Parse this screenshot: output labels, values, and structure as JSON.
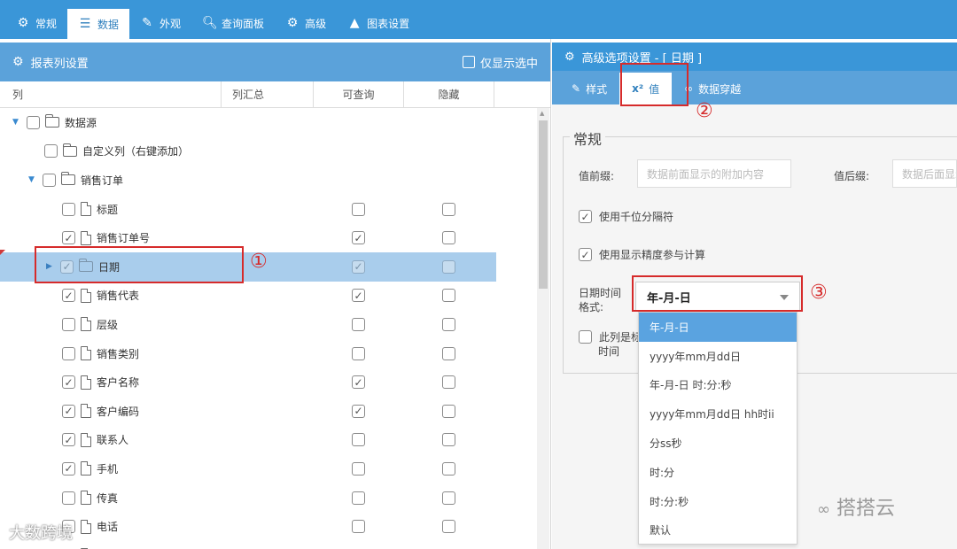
{
  "top_tabs": [
    {
      "label": "常规",
      "icon": "gear-icon"
    },
    {
      "label": "数据",
      "icon": "database-icon"
    },
    {
      "label": "外观",
      "icon": "magic-wand-icon"
    },
    {
      "label": "查询面板",
      "icon": "search-icon"
    },
    {
      "label": "高级",
      "icon": "gears-icon"
    },
    {
      "label": "图表设置",
      "icon": "area-chart-icon"
    }
  ],
  "active_top_tab": "数据",
  "left_panel": {
    "title": "报表列设置",
    "show_selected_only": "仅显示选中",
    "columns": [
      "列",
      "列汇总",
      "可查询",
      "隐藏"
    ],
    "rows": [
      {
        "label": "数据源",
        "type": "folder",
        "expanded": true,
        "checked": false,
        "queryable": null,
        "hidden": null
      },
      {
        "label": "自定义列（右键添加）",
        "type": "folder",
        "checked": false,
        "queryable": null,
        "hidden": null
      },
      {
        "label": "销售订单",
        "type": "folder",
        "expanded": true,
        "checked": false,
        "queryable": null,
        "hidden": null
      },
      {
        "label": "标题",
        "type": "file",
        "checked": false,
        "queryable": false,
        "hidden": false
      },
      {
        "label": "销售订单号",
        "type": "file",
        "checked": true,
        "queryable": true,
        "hidden": false
      },
      {
        "label": "日期",
        "type": "folder",
        "collapsed": true,
        "checked": true,
        "queryable": true,
        "hidden": false,
        "selected": true
      },
      {
        "label": "销售代表",
        "type": "file",
        "checked": true,
        "queryable": true,
        "hidden": false
      },
      {
        "label": "层级",
        "type": "file",
        "checked": false,
        "queryable": false,
        "hidden": false
      },
      {
        "label": "销售类别",
        "type": "file",
        "checked": false,
        "queryable": false,
        "hidden": false
      },
      {
        "label": "客户名称",
        "type": "file",
        "checked": true,
        "queryable": true,
        "hidden": false
      },
      {
        "label": "客户编码",
        "type": "file",
        "checked": true,
        "queryable": true,
        "hidden": false
      },
      {
        "label": "联系人",
        "type": "file",
        "checked": true,
        "queryable": false,
        "hidden": false
      },
      {
        "label": "手机",
        "type": "file",
        "checked": true,
        "queryable": false,
        "hidden": false
      },
      {
        "label": "传真",
        "type": "file",
        "checked": false,
        "queryable": false,
        "hidden": false
      },
      {
        "label": "电话",
        "type": "file",
        "checked": false,
        "queryable": false,
        "hidden": false
      },
      {
        "label": "",
        "type": "file",
        "checked": false,
        "queryable": false,
        "hidden": false
      }
    ]
  },
  "right_panel": {
    "title": "高级选项设置 - [ 日期 ]",
    "tabs": [
      {
        "label": "样式",
        "icon": "magic-wand-icon"
      },
      {
        "label": "值",
        "icon": "x-squared-icon",
        "icon_text": "x²"
      },
      {
        "label": "数据穿越",
        "icon": "link-icon"
      }
    ],
    "active_tab": "值",
    "section_title": "常规",
    "prefix_label": "值前缀:",
    "prefix_placeholder": "数据前面显示的附加内容",
    "suffix_label": "值后缀:",
    "suffix_placeholder": "数据后面显示",
    "option_thousands": "使用千位分隔符",
    "option_precision": "使用显示精度参与计算",
    "option_partial": "此列是标",
    "option_partial_2": "时间",
    "date_format_label_1": "日期时间",
    "date_format_label_2": "格式:",
    "date_format_value": "年-月-日",
    "date_format_options": [
      "年-月-日",
      "yyyy年mm月dd日",
      "年-月-日 时:分:秒",
      "yyyy年mm月dd日 hh时ii",
      "分ss秒",
      "时:分",
      "时:分:秒",
      "默认"
    ]
  },
  "annotations": [
    "①",
    "②",
    "③"
  ],
  "watermarks": {
    "wechat": "搭搭云",
    "bottom_left": "大数跨境"
  },
  "colors": {
    "header": "#3a96d8",
    "subheader": "#5ba2da",
    "selected_row": "#a9cdec",
    "annotation": "#d62b2b",
    "dropdown_active": "#5aa3e0"
  }
}
